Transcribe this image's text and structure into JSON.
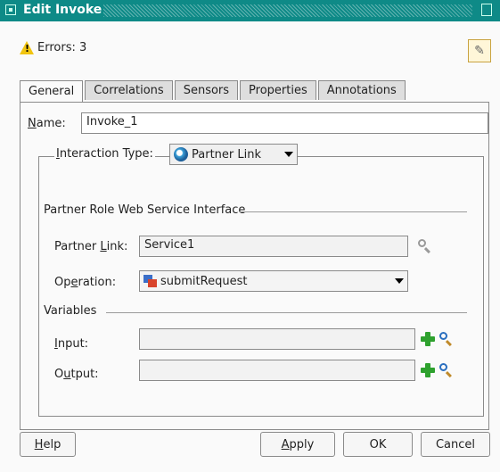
{
  "window": {
    "title": "Edit Invoke"
  },
  "errors": {
    "text": "Errors: 3"
  },
  "tabs": [
    {
      "label": "General"
    },
    {
      "label": "Correlations"
    },
    {
      "label": "Sensors"
    },
    {
      "label": "Properties"
    },
    {
      "label": "Annotations"
    }
  ],
  "general": {
    "name_label_accel": "N",
    "name_label_rest": "ame:",
    "name_value": "Invoke_1",
    "interaction_label_pre": " ",
    "interaction_label_accel": "I",
    "interaction_label_rest": "nteraction Type:",
    "interaction_value": "Partner Link",
    "section_partner_role": "Partner Role Web Service Interface",
    "partner_link_label_pre": "Partner ",
    "partner_link_label_accel": "L",
    "partner_link_label_rest": "ink:",
    "partner_link_value": "Service1",
    "operation_label_pre": "Op",
    "operation_label_accel": "e",
    "operation_label_rest": "ration:",
    "operation_value": "submitRequest",
    "section_variables": "Variables",
    "input_label_accel": "I",
    "input_label_rest": "nput:",
    "output_label_pre": "O",
    "output_label_accel": "u",
    "output_label_rest": "tput:"
  },
  "buttons": {
    "help_accel": "H",
    "help_rest": "elp",
    "apply_accel": "A",
    "apply_rest": "pply",
    "ok": "OK",
    "cancel": "Cancel"
  },
  "colors": {
    "titlebar": "#0e8a87",
    "search_icon_enabled": "#2a6fbf",
    "search_icon_disabled": "#9a9a9a",
    "add_icon": "#2ea12e"
  }
}
